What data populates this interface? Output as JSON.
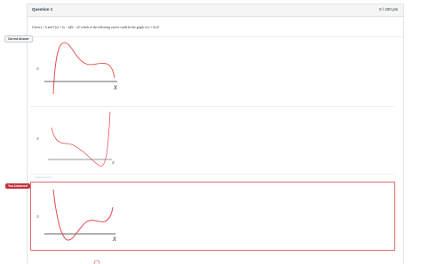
{
  "question": {
    "title": "Question 1",
    "points": "0 / 200 pts",
    "text": "Given a < b and f′(x) = (x − a)(b − x)² which of the following curves could be the graph of y = f(x)?"
  },
  "tags": {
    "correct": "Correct Answer",
    "you_answered": "You Answered"
  },
  "options": [
    {
      "axis_label": "x",
      "role": "correct"
    },
    {
      "axis_label": "x",
      "role": "plain"
    },
    {
      "axis_label": "x",
      "role": "selected"
    }
  ],
  "hint": "Selected option",
  "colors": {
    "curve": "#e2474c",
    "selected_border": "#e06a6e",
    "you_answered_bg": "#c0353a",
    "axis": "#333333"
  }
}
